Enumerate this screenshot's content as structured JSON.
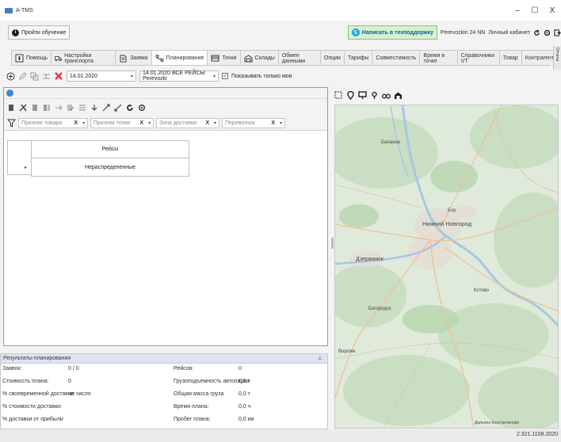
{
  "window": {
    "title": "A-TMS",
    "controls": [
      "–",
      "☐",
      "X"
    ]
  },
  "row2": {
    "training_label": "Пройти обучение",
    "support_label": "Написать в техподдержку",
    "user_label": "Perevozkin 24 NN",
    "cabinet_label": "Личный кабинет"
  },
  "tabs": [
    {
      "label": "Помощь"
    },
    {
      "label": "Настройки транспорта"
    },
    {
      "label": "Заявки"
    },
    {
      "label": "Планирование"
    },
    {
      "label": "Точки"
    },
    {
      "label": "Склады"
    },
    {
      "label": "Обмен данными"
    },
    {
      "label": "Опции"
    },
    {
      "label": "Тарифы"
    },
    {
      "label": "Совместимость"
    },
    {
      "label": "Время в точке"
    },
    {
      "label": "Справочники VT"
    },
    {
      "label": "Товар"
    },
    {
      "label": "Контрагенты"
    }
  ],
  "side_strip_label": "Отчеты",
  "toolbar": {
    "date_value": "14.01.2020",
    "plan_value": "14.01.2020 ВСЕ РЕЙСЫ Perevozki",
    "only_mine_label": "Показывать только мои",
    "only_mine_checked": "✓"
  },
  "filters": {
    "f1_placeholder": "Признак товара",
    "f2_placeholder": "Признак точки",
    "f3_placeholder": "Зона доставки",
    "f4_placeholder": "Перевозчик",
    "clear_mark": "X"
  },
  "grid": {
    "header": "Рейсы",
    "rows": [
      "Нераспределенные"
    ],
    "row_marker": "▸"
  },
  "results": {
    "title": "Результаты планирования",
    "pin": "⊥",
    "left": [
      {
        "label": "Заявок:",
        "value": "0 / 0"
      },
      {
        "label": "Стоимость плана:",
        "value": "0"
      },
      {
        "label": "% своевременной доставки:",
        "value": "не число"
      },
      {
        "label": "% стоимости доставки:",
        "value": ""
      },
      {
        "label": "% доставки от прибыли",
        "value": ""
      }
    ],
    "right": [
      {
        "label": "Рейсов:",
        "value": "0"
      },
      {
        "label": "Грузоподъемность автопарка",
        "value": "0,0 т"
      },
      {
        "label": "Общая масса груза",
        "value": "0,0 т"
      },
      {
        "label": "Время плана:",
        "value": "0,0 ч"
      },
      {
        "label": "Пробег плана:",
        "value": "0,0 км"
      }
    ]
  },
  "map": {
    "labels": {
      "balakhna": "Балахна",
      "bor": "Бор",
      "nn": "Нижний Новгород",
      "dzerzhinsk": "Дзержинск",
      "kstovo": "Кстово",
      "bogorodsk": "Богородск",
      "vorsma": "Ворсма",
      "dalneye": "Дальнее Константиново"
    }
  },
  "version": "2.321.1108.2020"
}
